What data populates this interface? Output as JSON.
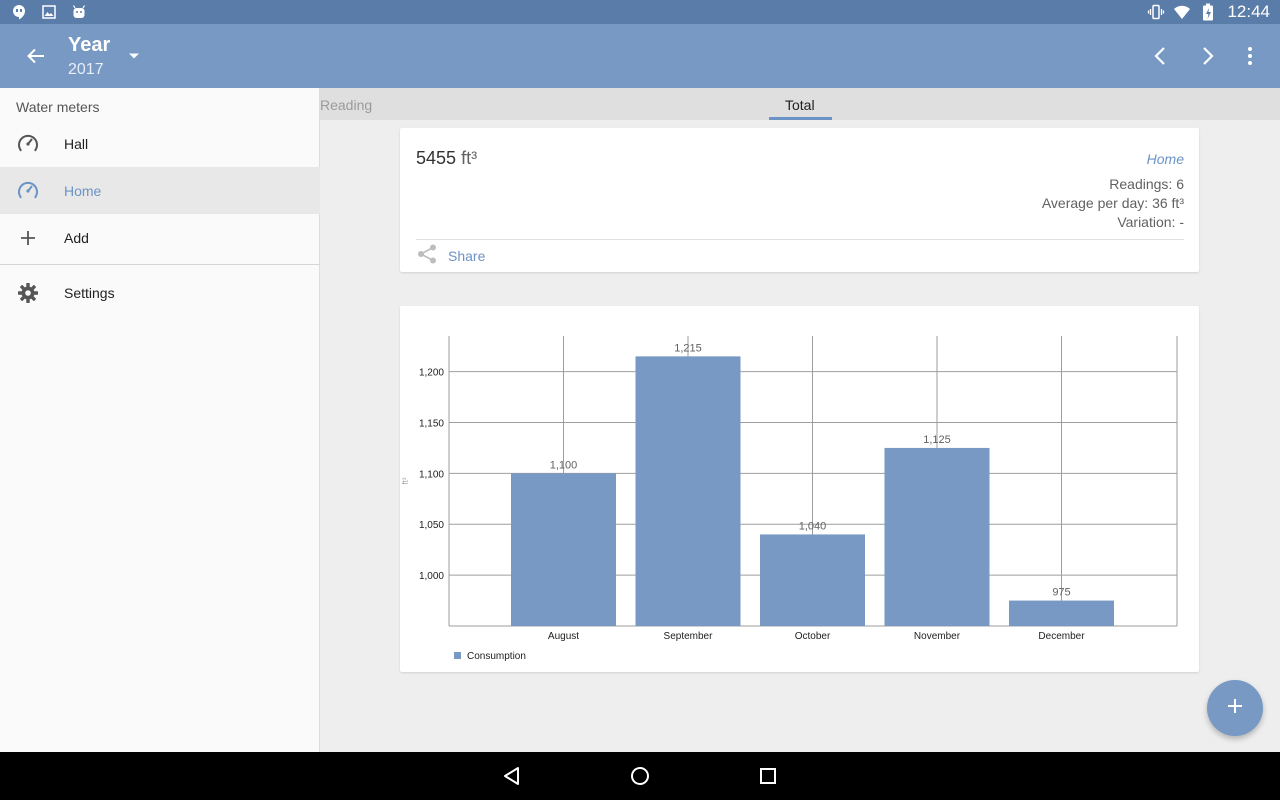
{
  "status_bar": {
    "time": "12:44"
  },
  "app_bar": {
    "title": "Year",
    "subtitle": "2017"
  },
  "sidebar": {
    "section_title": "Water meters",
    "items": [
      {
        "label": "Hall",
        "icon": "gauge-icon"
      },
      {
        "label": "Home",
        "icon": "gauge-icon",
        "active": true
      },
      {
        "label": "Add",
        "icon": "plus-icon"
      }
    ],
    "settings_label": "Settings"
  },
  "tabs": {
    "reading": "Reading",
    "total": "Total",
    "selected": "Total"
  },
  "summary": {
    "amount": "5455",
    "unit": "ft³",
    "meter_name": "Home",
    "readings": "Readings: 6",
    "average": "Average per day: 36 ft³",
    "variation": "Variation: -",
    "share_label": "Share"
  },
  "chart_data": {
    "type": "bar",
    "categories": [
      "August",
      "September",
      "October",
      "November",
      "December"
    ],
    "series": [
      {
        "name": "Consumption",
        "values": [
          1100,
          1215,
          1040,
          1125,
          975
        ],
        "color": "#7799c4"
      }
    ],
    "value_labels": [
      "1,100",
      "1,215",
      "1,040",
      "1,125",
      "975"
    ],
    "ylabel": "ft³",
    "ylim": [
      950,
      1235
    ],
    "yticks": [
      1000,
      1050,
      1100,
      1150,
      1200
    ],
    "ytick_labels": [
      "1,000",
      "1,050",
      "1,100",
      "1,150",
      "1,200"
    ],
    "grid": true,
    "legend": "bottom-left"
  },
  "colors": {
    "accent": "#7799c4",
    "appbar": "#7799c4",
    "statusbar": "#5a7ca8",
    "link": "#6b93c5"
  }
}
